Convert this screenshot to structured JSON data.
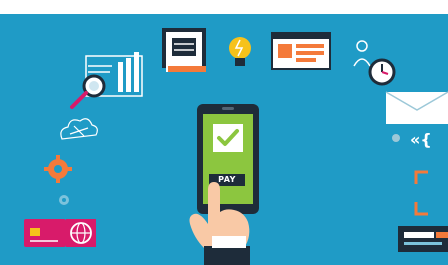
{
  "scene": {
    "background_color": "#1f9bc6",
    "pay_button_label": "PAY",
    "icons": [
      "analytics-chart-icon",
      "magnifier-icon",
      "document-icon",
      "lightbulb-icon",
      "browser-window-icon",
      "person-icon",
      "clock-icon",
      "envelope-icon",
      "cloud-network-icon",
      "gear-icon",
      "small-gear-icon",
      "credit-card-icon",
      "globe-icon",
      "smartphone-icon",
      "checkmark-icon",
      "hand-icon",
      "code-icon",
      "focus-frame-icon",
      "payment-terminal-icon"
    ],
    "colors": {
      "accent_orange": "#f47a3a",
      "accent_green": "#8cc63f",
      "accent_pink": "#d81b6a",
      "dark_navy": "#1e2c3a",
      "bulb_yellow": "#f6c21b"
    }
  }
}
